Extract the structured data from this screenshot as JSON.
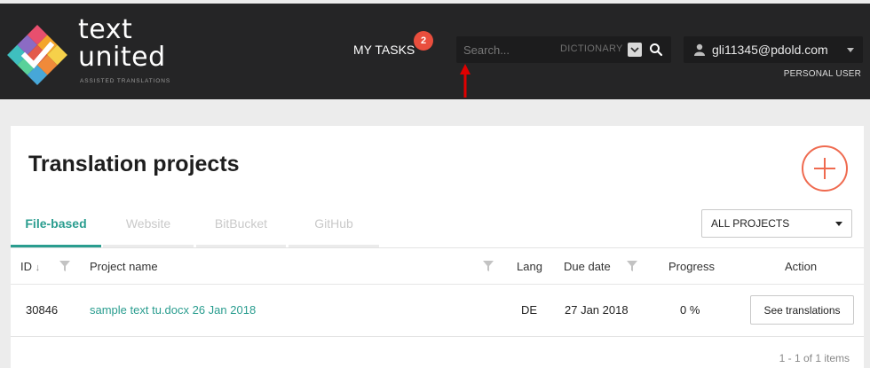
{
  "brand": {
    "line1": "text",
    "line2": "united",
    "tagline": "ASSISTED TRANSLATIONS",
    "colors": [
      "#e84f6e",
      "#f4a52b",
      "#3fbfbf",
      "#8b6bc4",
      "#f6d14a",
      "#5ad19a"
    ]
  },
  "header": {
    "my_tasks_label": "MY TASKS",
    "tasks_count": "2",
    "search": {
      "placeholder": "Search...",
      "scope": "DICTIONARY",
      "icon": "search-icon"
    },
    "user": {
      "email": "gli11345@pdold.com",
      "role": "PERSONAL USER",
      "icon": "user-icon"
    }
  },
  "page": {
    "title": "Translation projects",
    "add_icon": "plus-circle-icon",
    "tabs": [
      {
        "label": "File-based",
        "active": true
      },
      {
        "label": "Website",
        "active": false
      },
      {
        "label": "BitBucket",
        "active": false
      },
      {
        "label": "GitHub",
        "active": false
      }
    ],
    "filter": {
      "selected": "ALL PROJECTS"
    }
  },
  "table": {
    "columns": {
      "id": "ID",
      "sort_indicator": "↓",
      "project_name": "Project name",
      "lang": "Lang",
      "due_date": "Due date",
      "progress": "Progress",
      "action": "Action"
    },
    "rows": [
      {
        "id": "30846",
        "name": "sample text tu.docx 26 Jan 2018",
        "lang": "DE",
        "due_date": "27 Jan 2018",
        "progress": "0 %",
        "action": "See translations"
      }
    ],
    "pagination": "1 - 1 of 1 items"
  },
  "colors": {
    "accent": "#2a9d8f",
    "add_button": "#ef6a4f",
    "badge": "#e94e3d",
    "header_bg": "#252526",
    "annotation_arrow": "#e00000"
  }
}
